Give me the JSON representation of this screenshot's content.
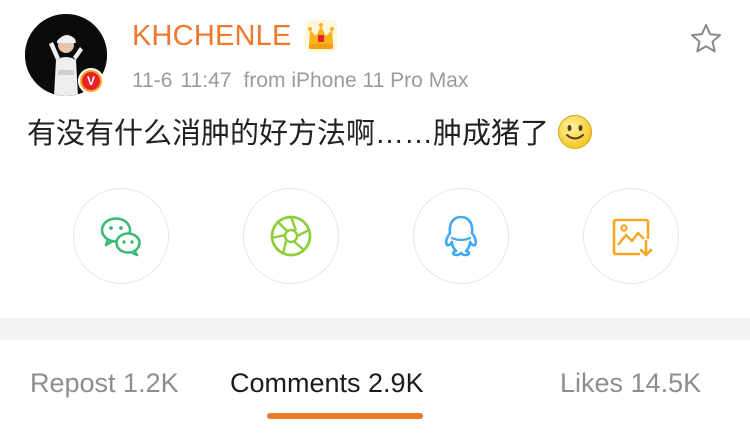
{
  "post": {
    "author": "KHCHENLE",
    "date": "11-6",
    "time": "11:47",
    "source": "from iPhone 11 Pro Max",
    "text": "有没有什么消肿的好方法啊……肿成猪了",
    "avatar_badge": "V",
    "member_badge_icon": "crown-icon",
    "favorite_icon": "star-outline-icon",
    "emoji_icon": "smiley-icon"
  },
  "share": [
    {
      "name": "wechat",
      "icon": "wechat-icon",
      "color": "#3cb878"
    },
    {
      "name": "moments",
      "icon": "moments-icon",
      "color": "#8ccf3a"
    },
    {
      "name": "qq",
      "icon": "qq-icon",
      "color": "#3fa9f5"
    },
    {
      "name": "save-image",
      "icon": "save-image-icon",
      "color": "#f5a623"
    }
  ],
  "tabs": {
    "repost": "Repost 1.2K",
    "comments": "Comments 2.9K",
    "likes": "Likes 14.5K",
    "active": "comments"
  },
  "colors": {
    "accent": "#f0782d",
    "meta_text": "#9b9b9b",
    "body_text": "#222222",
    "divider": "#f2f2f2"
  }
}
